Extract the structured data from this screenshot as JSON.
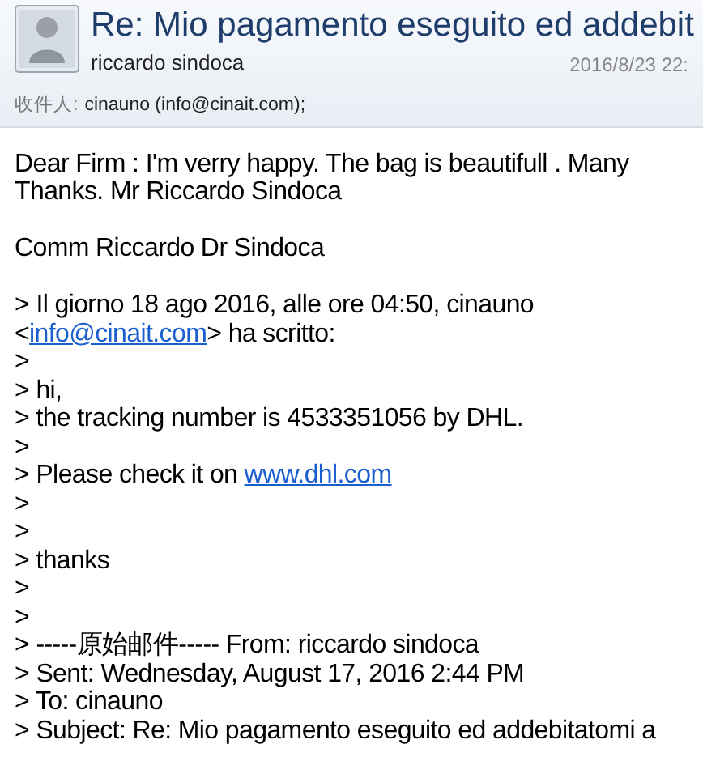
{
  "header": {
    "subject": "Re: Mio pagamento eseguito ed addebit",
    "sender": "riccardo sindoca",
    "date": "2016/8/23 22:",
    "recipient_label": "收件人:",
    "recipient": "cinauno (info@cinait.com);"
  },
  "body": [
    {
      "kind": "text",
      "parts": [
        {
          "kind": "text",
          "text": "Dear Firm : I'm verry happy. The bag is beautifull . Many Thanks. Mr Riccardo Sindoca"
        }
      ]
    },
    {
      "kind": "gap"
    },
    {
      "kind": "text",
      "parts": [
        {
          "kind": "text",
          "text": "Comm Riccardo Dr Sindoca"
        }
      ]
    },
    {
      "kind": "gap"
    },
    {
      "kind": "text",
      "parts": [
        {
          "kind": "text",
          "text": "> Il giorno 18 ago 2016, alle ore 04:50, cinauno"
        }
      ]
    },
    {
      "kind": "text",
      "parts": [
        {
          "kind": "text",
          "text": "<"
        },
        {
          "kind": "link",
          "text": "info@cinait.com"
        },
        {
          "kind": "text",
          "text": "> ha scritto:"
        }
      ]
    },
    {
      "kind": "text",
      "parts": [
        {
          "kind": "text",
          "text": ">"
        }
      ]
    },
    {
      "kind": "text",
      "parts": [
        {
          "kind": "text",
          "text": "> hi,"
        }
      ]
    },
    {
      "kind": "text",
      "parts": [
        {
          "kind": "text",
          "text": "> the tracking number is  4533351056 by DHL."
        }
      ]
    },
    {
      "kind": "text",
      "parts": [
        {
          "kind": "text",
          "text": ">"
        }
      ]
    },
    {
      "kind": "text",
      "parts": [
        {
          "kind": "text",
          "text": "> Please check it on "
        },
        {
          "kind": "link",
          "text": "www.dhl.com"
        }
      ]
    },
    {
      "kind": "text",
      "parts": [
        {
          "kind": "text",
          "text": ">"
        }
      ]
    },
    {
      "kind": "text",
      "parts": [
        {
          "kind": "text",
          "text": ">"
        }
      ]
    },
    {
      "kind": "text",
      "parts": [
        {
          "kind": "text",
          "text": "> thanks"
        }
      ]
    },
    {
      "kind": "text",
      "parts": [
        {
          "kind": "text",
          "text": ">"
        }
      ]
    },
    {
      "kind": "text",
      "parts": [
        {
          "kind": "text",
          "text": ">"
        }
      ]
    },
    {
      "kind": "text",
      "parts": [
        {
          "kind": "text",
          "text": "> -----原始邮件----- From: riccardo sindoca"
        }
      ]
    },
    {
      "kind": "text",
      "parts": [
        {
          "kind": "text",
          "text": "> Sent: Wednesday, August 17, 2016 2:44 PM"
        }
      ]
    },
    {
      "kind": "text",
      "parts": [
        {
          "kind": "text",
          "text": "> To: cinauno"
        }
      ]
    },
    {
      "kind": "text",
      "parts": [
        {
          "kind": "text",
          "text": "> Subject: Re: Mio pagamento eseguito ed addebitatomi a"
        }
      ]
    }
  ]
}
